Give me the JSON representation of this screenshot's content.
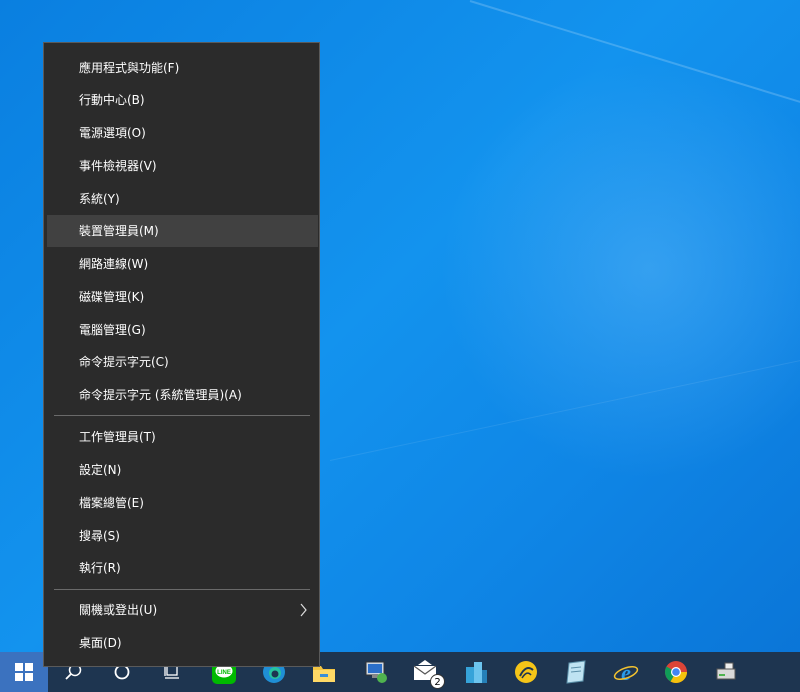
{
  "context_menu": {
    "items": [
      {
        "label": "應用程式與功能(F)"
      },
      {
        "label": "行動中心(B)"
      },
      {
        "label": "電源選項(O)"
      },
      {
        "label": "事件檢視器(V)"
      },
      {
        "label": "系統(Y)"
      },
      {
        "label": "裝置管理員(M)",
        "highlighted": true
      },
      {
        "label": "網路連線(W)"
      },
      {
        "label": "磁碟管理(K)"
      },
      {
        "label": "電腦管理(G)"
      },
      {
        "label": "命令提示字元(C)"
      },
      {
        "label": "命令提示字元 (系統管理員)(A)"
      },
      {
        "label": "工作管理員(T)"
      },
      {
        "label": "設定(N)"
      },
      {
        "label": "檔案總管(E)"
      },
      {
        "label": "搜尋(S)"
      },
      {
        "label": "執行(R)"
      },
      {
        "label": "關機或登出(U)",
        "submenu": true,
        "submenu_icon": "chevron-right-icon"
      },
      {
        "label": "桌面(D)"
      }
    ]
  },
  "taskbar": {
    "icons": [
      "windows-start-icon",
      "search-icon",
      "cortana-icon",
      "task-view-icon",
      "line-app-icon",
      "edge-icon",
      "file-explorer-icon",
      "remote-desktop-icon",
      "mail-icon",
      "buildings-app-icon",
      "sun-app-icon",
      "notepad-app-icon",
      "internet-explorer-icon",
      "chrome-icon",
      "network-drive-icon"
    ],
    "mail_badge": "2"
  },
  "colors": {
    "menu_bg": "#2b2b2b",
    "menu_highlight": "#414141",
    "taskbar_bg": "#1e3550",
    "start_bg": "#3b72bf"
  }
}
